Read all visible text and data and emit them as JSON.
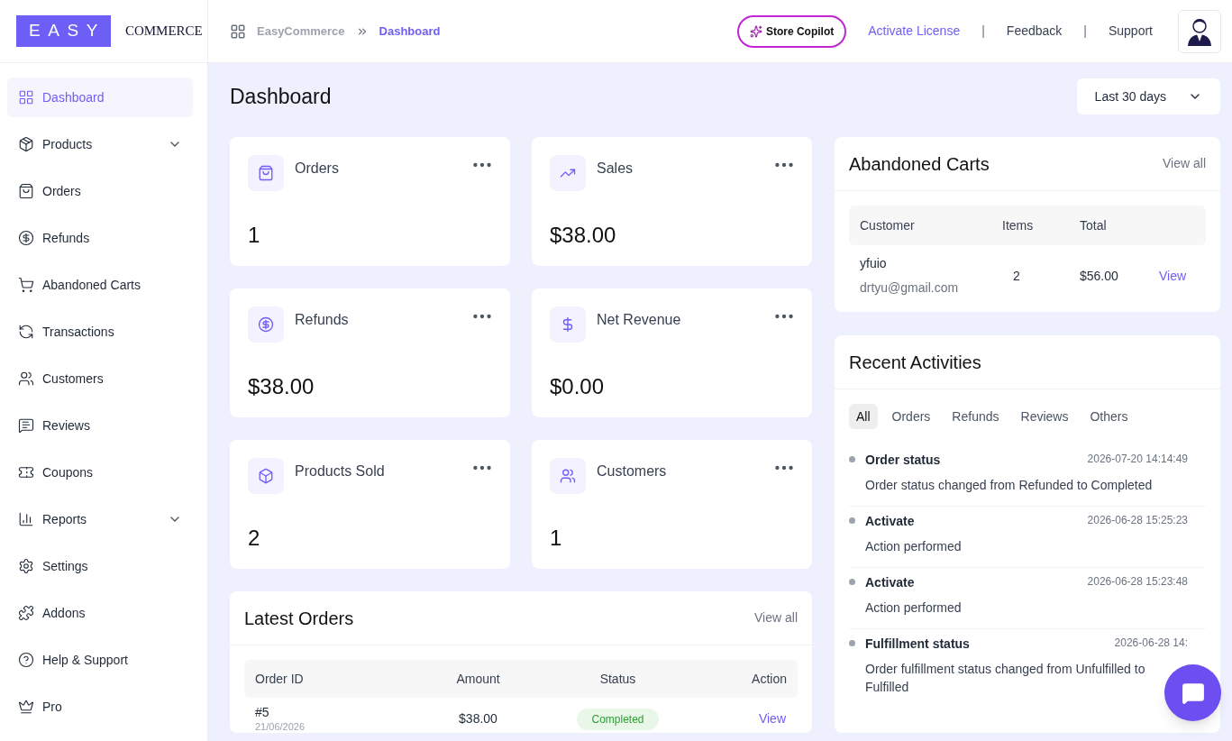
{
  "logo": {
    "mark": "EASY",
    "word": "COMMERCE"
  },
  "breadcrumb": [
    {
      "label": "EasyCommerce",
      "selected": false
    },
    {
      "label": "Dashboard",
      "selected": true
    }
  ],
  "header": {
    "copilot": "Store Copilot",
    "links": [
      {
        "label": "Activate License",
        "selected": true
      },
      {
        "label": "Feedback",
        "selected": false
      },
      {
        "label": "Support",
        "selected": false
      }
    ],
    "separator": "|"
  },
  "sidebar": {
    "items": [
      {
        "label": "Dashboard",
        "selected": true,
        "has_submenu": false
      },
      {
        "label": "Products",
        "selected": false,
        "has_submenu": true
      },
      {
        "label": "Orders",
        "selected": false,
        "has_submenu": false
      },
      {
        "label": "Refunds",
        "selected": false,
        "has_submenu": false
      },
      {
        "label": "Abandoned Carts",
        "selected": false,
        "has_submenu": false
      },
      {
        "label": "Transactions",
        "selected": false,
        "has_submenu": false
      },
      {
        "label": "Customers",
        "selected": false,
        "has_submenu": false
      },
      {
        "label": "Reviews",
        "selected": false,
        "has_submenu": false
      },
      {
        "label": "Coupons",
        "selected": false,
        "has_submenu": false
      },
      {
        "label": "Reports",
        "selected": false,
        "has_submenu": true
      },
      {
        "label": "Settings",
        "selected": false,
        "has_submenu": false
      },
      {
        "label": "Addons",
        "selected": false,
        "has_submenu": false
      },
      {
        "label": "Help & Support",
        "selected": false,
        "has_submenu": false
      },
      {
        "label": "Pro",
        "selected": false,
        "has_submenu": false
      }
    ]
  },
  "page": {
    "title": "Dashboard",
    "range": "Last 30 days"
  },
  "stats": [
    {
      "label": "Orders",
      "value": "1"
    },
    {
      "label": "Sales",
      "value": "$38.00"
    },
    {
      "label": "Refunds",
      "value": "$38.00"
    },
    {
      "label": "Net Revenue",
      "value": "$0.00"
    },
    {
      "label": "Products Sold",
      "value": "2"
    },
    {
      "label": "Customers",
      "value": "1"
    }
  ],
  "latest_orders": {
    "title": "Latest Orders",
    "view_all": "View all",
    "columns": [
      "Order ID",
      "Amount",
      "Status",
      "Action"
    ],
    "rows": [
      {
        "id": "#5",
        "date": "21/06/2026",
        "amount": "$38.00",
        "status": "Completed",
        "action": "View"
      }
    ]
  },
  "abandoned_carts": {
    "title": "Abandoned Carts",
    "view_all": "View all",
    "columns": [
      "Customer",
      "Items",
      "Total"
    ],
    "rows": [
      {
        "name": "yfuio",
        "email": "drtyu@gmail.com",
        "items": "2",
        "total": "$56.00",
        "action": "View"
      }
    ]
  },
  "recent_activities": {
    "title": "Recent Activities",
    "tabs": [
      {
        "label": "All",
        "selected": true
      },
      {
        "label": "Orders",
        "selected": false
      },
      {
        "label": "Refunds",
        "selected": false
      },
      {
        "label": "Reviews",
        "selected": false
      },
      {
        "label": "Others",
        "selected": false
      }
    ],
    "items": [
      {
        "title": "Order status",
        "time": "2026-07-20 14:14:49",
        "text": "Order status changed from Refunded to Completed"
      },
      {
        "title": "Activate",
        "time": "2026-06-28 15:25:23",
        "text": "Action performed"
      },
      {
        "title": "Activate",
        "time": "2026-06-28 15:23:48",
        "text": "Action performed"
      },
      {
        "title": "Fulfillment status",
        "time": "2026-06-28 14:",
        "text": "Order fulfillment status changed from Unfulfilled to Fulfilled"
      }
    ]
  }
}
